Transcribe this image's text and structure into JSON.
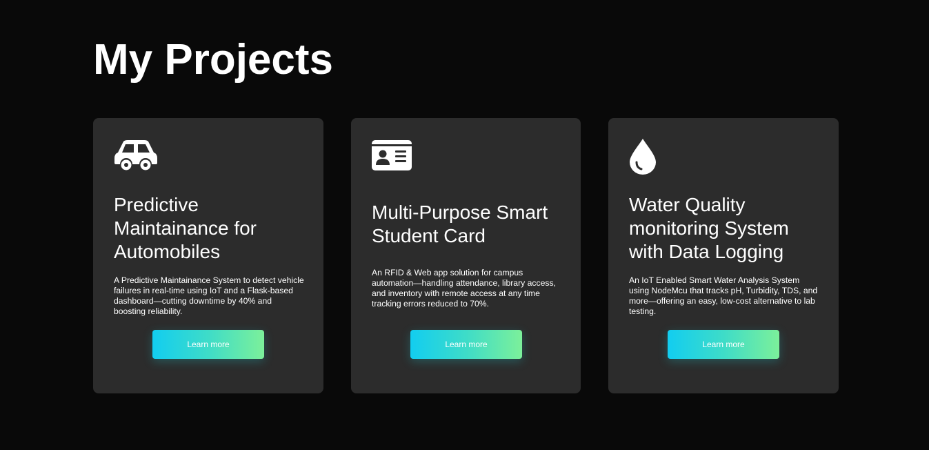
{
  "page": {
    "title": "My Projects"
  },
  "colors": {
    "background": "#090909",
    "card": "#2c2c2c",
    "button_gradient_start": "#12cdf0",
    "button_gradient_end": "#7cf09a",
    "text": "#ffffff"
  },
  "projects": [
    {
      "icon": "car-icon",
      "title": "Predictive Maintainance for Automobiles",
      "description": "A Predictive Maintainance System to detect vehicle failures in real-time using IoT and a Flask-based dashboard—cutting downtime by 40% and boosting reliability.",
      "button_label": "Learn more"
    },
    {
      "icon": "id-card-icon",
      "title": "Multi-Purpose Smart Student Card",
      "description": "An RFID & Web app solution for campus automation—handling attendance, library access, and inventory with remote access at any time tracking errors reduced to 70%.",
      "button_label": "Learn more"
    },
    {
      "icon": "water-drop-icon",
      "title": "Water Quality monitoring System with Data Logging",
      "description": "An IoT Enabled Smart Water Analysis System using NodeMcu that tracks pH, Turbidity, TDS, and more—offering an easy, low-cost alternative to lab testing.",
      "button_label": "Learn more"
    }
  ]
}
